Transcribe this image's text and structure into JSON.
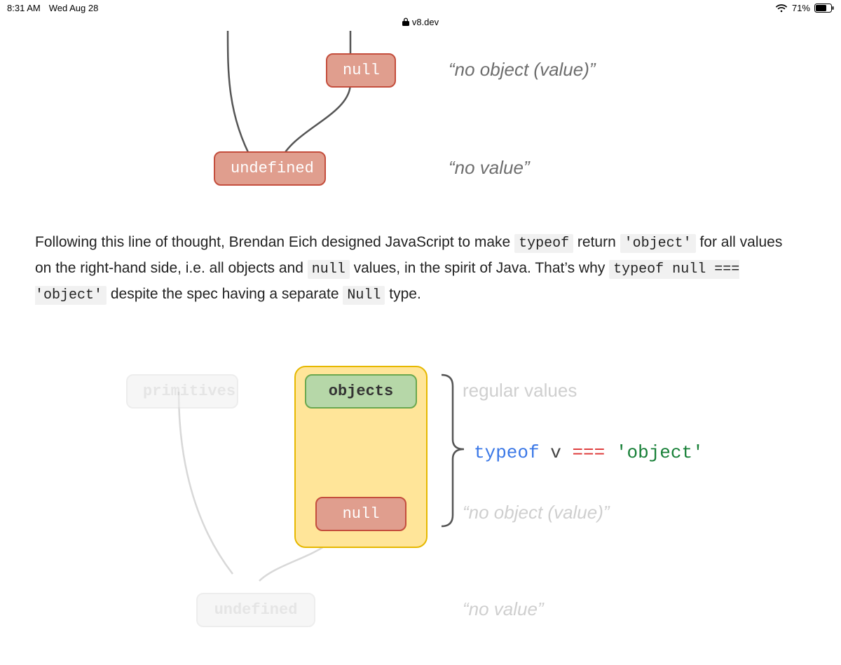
{
  "status_bar": {
    "time": "8:31 AM",
    "date": "Wed Aug 28",
    "battery_pct": "71%"
  },
  "url_bar": {
    "host": "v8.dev"
  },
  "diagram1": {
    "null_label": "null",
    "undefined_label": "undefined",
    "null_annot": "“no object (value)”",
    "undefined_annot": "“no value”"
  },
  "paragraph": {
    "pre": "Following this line of thought, Brendan Eich designed JavaScript to make ",
    "code1": "typeof",
    "mid1": " return ",
    "code2": "'object'",
    "mid2": " for all values on the right-hand side, i.e. all objects and ",
    "code3": "null",
    "mid3": " values, in the spirit of Java. That’s why ",
    "code4": "typeof null === 'object'",
    "mid4": " despite the spec having a separate ",
    "code5": "Null",
    "post": " type."
  },
  "diagram2": {
    "primitives_label": "primitives",
    "objects_label": "objects",
    "null_label": "null",
    "undefined_label": "undefined",
    "regular_values_annot": "regular values",
    "typeof_expr": {
      "kw": "typeof",
      "var": "v",
      "op": "===",
      "str": "'object'"
    },
    "null_annot": "“no object (value)”",
    "undefined_annot": "“no value”"
  }
}
